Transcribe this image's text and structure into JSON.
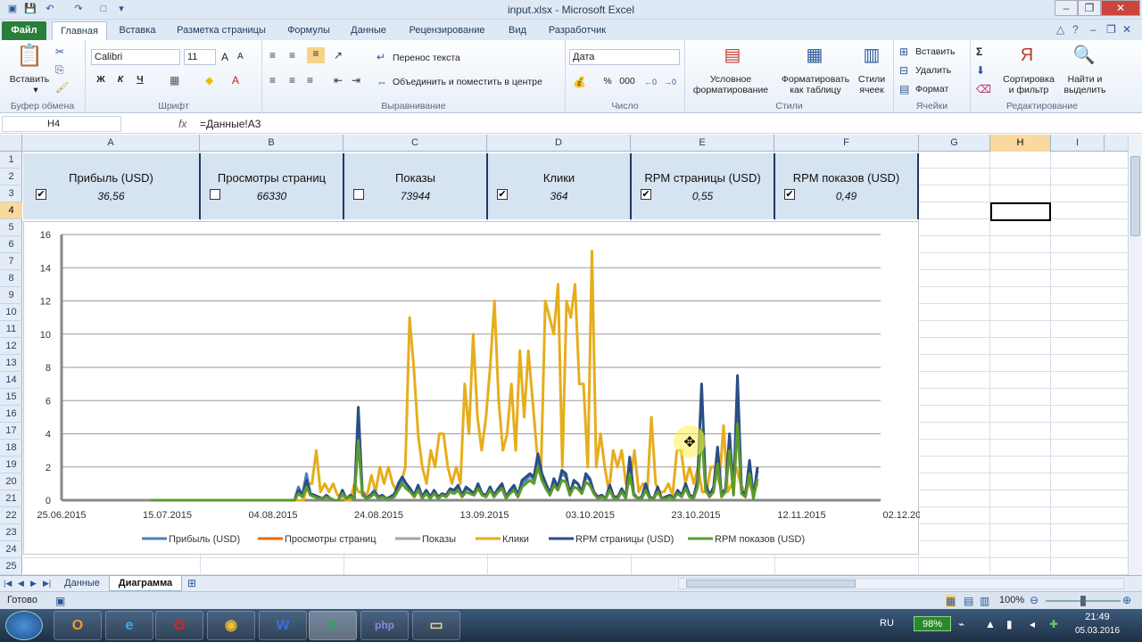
{
  "window": {
    "title": "input.xlsx  -  Microsoft Excel"
  },
  "ribbon_tabs": [
    "Файл",
    "Главная",
    "Вставка",
    "Разметка страницы",
    "Формулы",
    "Данные",
    "Рецензирование",
    "Вид",
    "Разработчик"
  ],
  "ribbon": {
    "paste": "Вставить",
    "font_name": "Calibri",
    "font_size": "11",
    "bold": "Ж",
    "italic": "К",
    "underline": "Ч",
    "wrap_text": "Перенос текста",
    "merge_center": "Объединить и поместить в центре",
    "number_format": "Дата",
    "percent": "%",
    "thousands": "000",
    "cond_format": "Условное форматирование",
    "format_table": "Форматировать как таблицу",
    "cell_styles": "Стили ячеек",
    "insert": "Вставить",
    "delete": "Удалить",
    "format": "Формат",
    "sort_filter": "Сортировка и фильтр",
    "find_select": "Найти и выделить",
    "groups": {
      "clipboard": "Буфер обмена",
      "font": "Шрифт",
      "alignment": "Выравнивание",
      "number": "Число",
      "styles": "Стили",
      "cells": "Ячейки",
      "editing": "Редактирование"
    }
  },
  "formula_bar": {
    "name_box": "H4",
    "fx": "fx",
    "formula": "=Данные!A3"
  },
  "columns": [
    "A",
    "B",
    "C",
    "D",
    "E",
    "F",
    "G",
    "H",
    "I"
  ],
  "rows": [
    "1",
    "2",
    "3",
    "4",
    "5",
    "6",
    "7",
    "8",
    "9",
    "10",
    "11",
    "12",
    "13",
    "14",
    "15",
    "16",
    "17",
    "18",
    "19",
    "20",
    "21",
    "22",
    "23",
    "24",
    "25"
  ],
  "cards": [
    {
      "title": "Прибыль (USD)",
      "value": "36,56",
      "checked": true
    },
    {
      "title": "Просмотры страниц",
      "value": "66330",
      "checked": false
    },
    {
      "title": "Показы",
      "value": "73944",
      "checked": false
    },
    {
      "title": "Клики",
      "value": "364",
      "checked": true
    },
    {
      "title": "RPM страницы (USD)",
      "value": "0,55",
      "checked": true
    },
    {
      "title": "RPM показов (USD)",
      "value": "0,49",
      "checked": true
    }
  ],
  "chart_data": {
    "type": "line",
    "x_tick_labels": [
      "25.06.2015",
      "15.07.2015",
      "04.08.2015",
      "24.08.2015",
      "13.09.2015",
      "03.10.2015",
      "23.10.2015",
      "12.11.2015",
      "02.12.2015"
    ],
    "y_tick_labels": [
      "0",
      "2",
      "4",
      "6",
      "8",
      "10",
      "12",
      "14",
      "16"
    ],
    "ylim": [
      0,
      16
    ],
    "grid": true,
    "legend_position": "bottom",
    "series": [
      {
        "name": "Прибыль (USD)",
        "color": "#4f81bd",
        "values": [
          0,
          0,
          0,
          0,
          0,
          0,
          0,
          0,
          0,
          0,
          0,
          0,
          0,
          0,
          0,
          0,
          0,
          0,
          0,
          0,
          0,
          0,
          0,
          0,
          0,
          0,
          0,
          0,
          0,
          0,
          0,
          0,
          0,
          0,
          0,
          0,
          0,
          0.8,
          0.3,
          1.6,
          0.4,
          0.3,
          0.2,
          0.1,
          0.3,
          0.1,
          0,
          0,
          0.6,
          0.1,
          0.3,
          0.1,
          5.2,
          0.5,
          0.1,
          0.3,
          0.6,
          0.2,
          0.3,
          0.1,
          0.2,
          0.4,
          0.8,
          1.2,
          1.0,
          0.6,
          0.3,
          0.9,
          0.2,
          0.6,
          0.2,
          0.5,
          0.2,
          0.4,
          0.3,
          0.6,
          0.6,
          0.8,
          0.3,
          0.7,
          0.6,
          0.4,
          0.9,
          0.4,
          0.3,
          0.8,
          0.3,
          0.6,
          0.9,
          0.2,
          0.5,
          0.8,
          0.3,
          1.0,
          1.2,
          1.5,
          1.2,
          2.5,
          1.6,
          1.0,
          0.4,
          1.2,
          0.8,
          1.6,
          1.4,
          0.4,
          1.1,
          1.0,
          0.5,
          1.4,
          1.2,
          0.5,
          0.2,
          0.3,
          0.1,
          0.9,
          0.2,
          0.2,
          0.6,
          0.2,
          2.2,
          0.3,
          0.1,
          0.2,
          0.8,
          0.2,
          0.1,
          0.7,
          0.1,
          0.2,
          0.3,
          0.1,
          0.5,
          0.3,
          0.9,
          0.3,
          0.2,
          1.0,
          4.2,
          0.8,
          0.3,
          0.6,
          2.8,
          0.3,
          0.6,
          3.6,
          0.4,
          6.0,
          0.5,
          0.3,
          2.2,
          0.2,
          1.8
        ]
      },
      {
        "name": "Просмотры страниц",
        "color": "#e46c0a",
        "values": []
      },
      {
        "name": "Показы",
        "color": "#a5a5a5",
        "values": []
      },
      {
        "name": "Клики",
        "color": "#e6ad1c",
        "values": [
          0,
          0,
          0,
          0,
          0,
          0,
          0,
          0,
          0,
          0,
          0,
          0,
          0,
          0,
          0,
          0,
          0,
          0,
          0,
          0,
          0,
          0,
          0,
          0,
          0,
          0,
          0,
          0,
          0,
          0,
          0,
          0,
          0,
          0,
          0,
          0,
          0,
          1.0,
          1.0,
          3.0,
          0.5,
          1.0,
          0.5,
          1.0,
          0.3,
          0.3,
          0,
          0,
          1.0,
          0.5,
          0.5,
          0.3,
          1.5,
          0.5,
          2.0,
          1.0,
          2.0,
          1.0,
          0.5,
          1.0,
          2.0,
          11.0,
          8.0,
          4.0,
          2.0,
          1.0,
          3.0,
          2.0,
          4.0,
          4.0,
          2.0,
          1.0,
          2.0,
          1.0,
          7.0,
          4.0,
          10.0,
          5.0,
          3.0,
          5.0,
          8.0,
          12.0,
          6.0,
          3.0,
          4.0,
          7.0,
          3.0,
          9.0,
          5.0,
          9.0,
          6.0,
          3.0,
          2.0,
          12.0,
          11.0,
          10.0,
          13.0,
          2.0,
          12.0,
          11.0,
          13.0,
          7.0,
          7.0,
          2.0,
          15.0,
          2.0,
          4.0,
          2.0,
          0.5,
          3.0,
          2.0,
          3.0,
          1.0,
          1.0,
          3.0,
          0.5,
          1.0,
          0.5,
          5.0,
          1.0,
          0.5,
          0.5,
          1.0,
          0.3,
          3.0,
          3.0,
          1.0,
          2.0,
          1.0,
          2.0,
          0.5,
          0.5,
          2.0,
          2.0,
          1.0,
          4.5,
          0.5,
          1.0,
          2.0,
          1.0,
          0.5,
          1.0,
          0.5,
          1.0
        ]
      },
      {
        "name": "RPM страницы (USD)",
        "color": "#2c4d86",
        "values": [
          0,
          0,
          0,
          0,
          0,
          0,
          0,
          0,
          0,
          0,
          0,
          0,
          0,
          0,
          0,
          0,
          0,
          0,
          0,
          0,
          0,
          0,
          0,
          0,
          0,
          0,
          0,
          0,
          0,
          0,
          0,
          0,
          0,
          0,
          0,
          0,
          0,
          0.6,
          0.3,
          1.2,
          0.4,
          0.3,
          0.2,
          0.1,
          0.3,
          0.1,
          0,
          0,
          0.6,
          0.1,
          0.3,
          0.1,
          5.6,
          0.4,
          0.1,
          0.3,
          0.5,
          0.2,
          0.3,
          0.1,
          0.2,
          0.3,
          1.0,
          1.4,
          1.0,
          0.7,
          0.3,
          0.9,
          0.2,
          0.6,
          0.2,
          0.6,
          0.2,
          0.4,
          0.3,
          0.7,
          0.6,
          0.9,
          0.3,
          0.8,
          0.6,
          0.4,
          1.0,
          0.4,
          0.3,
          0.8,
          0.3,
          0.7,
          1.0,
          0.2,
          0.6,
          0.9,
          0.3,
          1.2,
          1.4,
          1.6,
          1.4,
          2.8,
          1.6,
          1.0,
          0.4,
          1.3,
          0.8,
          1.8,
          1.6,
          0.4,
          1.2,
          1.0,
          0.5,
          1.6,
          1.3,
          0.5,
          0.2,
          0.3,
          0.1,
          0.9,
          0.2,
          0.2,
          0.7,
          0.2,
          2.6,
          0.4,
          0.1,
          0.2,
          1.0,
          0.2,
          0.1,
          0.8,
          0.1,
          0.2,
          0.3,
          0.1,
          0.6,
          0.3,
          1.0,
          0.3,
          0.2,
          1.2,
          7.0,
          1.0,
          0.3,
          0.8,
          3.2,
          0.3,
          0.7,
          4.0,
          0.5,
          7.5,
          0.6,
          0.3,
          2.4,
          0.2,
          2.0
        ]
      },
      {
        "name": "RPM показов (USD)",
        "color": "#5b9a2c",
        "values": [
          0,
          0,
          0,
          0,
          0,
          0,
          0,
          0,
          0,
          0,
          0,
          0,
          0,
          0,
          0,
          0,
          0,
          0,
          0,
          0,
          0,
          0,
          0,
          0,
          0,
          0,
          0,
          0,
          0,
          0,
          0,
          0,
          0,
          0,
          0,
          0,
          0,
          0.4,
          0.2,
          0.8,
          0.3,
          0.2,
          0.1,
          0.1,
          0.2,
          0.1,
          0,
          0,
          0.4,
          0.1,
          0.2,
          0.1,
          3.6,
          0.3,
          0.1,
          0.2,
          0.4,
          0.1,
          0.2,
          0.1,
          0.1,
          0.2,
          0.6,
          1.0,
          0.7,
          0.5,
          0.2,
          0.6,
          0.1,
          0.4,
          0.1,
          0.4,
          0.1,
          0.3,
          0.2,
          0.5,
          0.4,
          0.6,
          0.2,
          0.5,
          0.4,
          0.3,
          0.7,
          0.3,
          0.2,
          0.6,
          0.2,
          0.5,
          0.7,
          0.1,
          0.4,
          0.6,
          0.2,
          0.8,
          1.0,
          1.2,
          1.0,
          2.0,
          1.2,
          0.7,
          0.3,
          0.9,
          0.6,
          1.2,
          1.1,
          0.3,
          0.8,
          0.7,
          0.4,
          1.1,
          0.9,
          0.4,
          0.1,
          0.2,
          0.1,
          0.6,
          0.1,
          0.1,
          0.5,
          0.1,
          1.6,
          0.3,
          0.1,
          0.1,
          0.6,
          0.1,
          0.1,
          0.5,
          0.1,
          0.1,
          0.2,
          0.1,
          0.4,
          0.2,
          0.7,
          0.2,
          0.1,
          0.8,
          4.2,
          0.6,
          0.2,
          0.5,
          2.2,
          0.2,
          0.5,
          3.0,
          0.3,
          4.6,
          0.4,
          0.2,
          1.6,
          0.1,
          1.3
        ]
      }
    ]
  },
  "sheets": [
    "Данные",
    "Диаграмма"
  ],
  "active_sheet": "Диаграмма",
  "status": {
    "ready": "Готово",
    "zoom": "100%"
  },
  "taskbar": {
    "lang": "RU",
    "battery": "98%",
    "time": "21:49",
    "date": "05.03.2016"
  }
}
